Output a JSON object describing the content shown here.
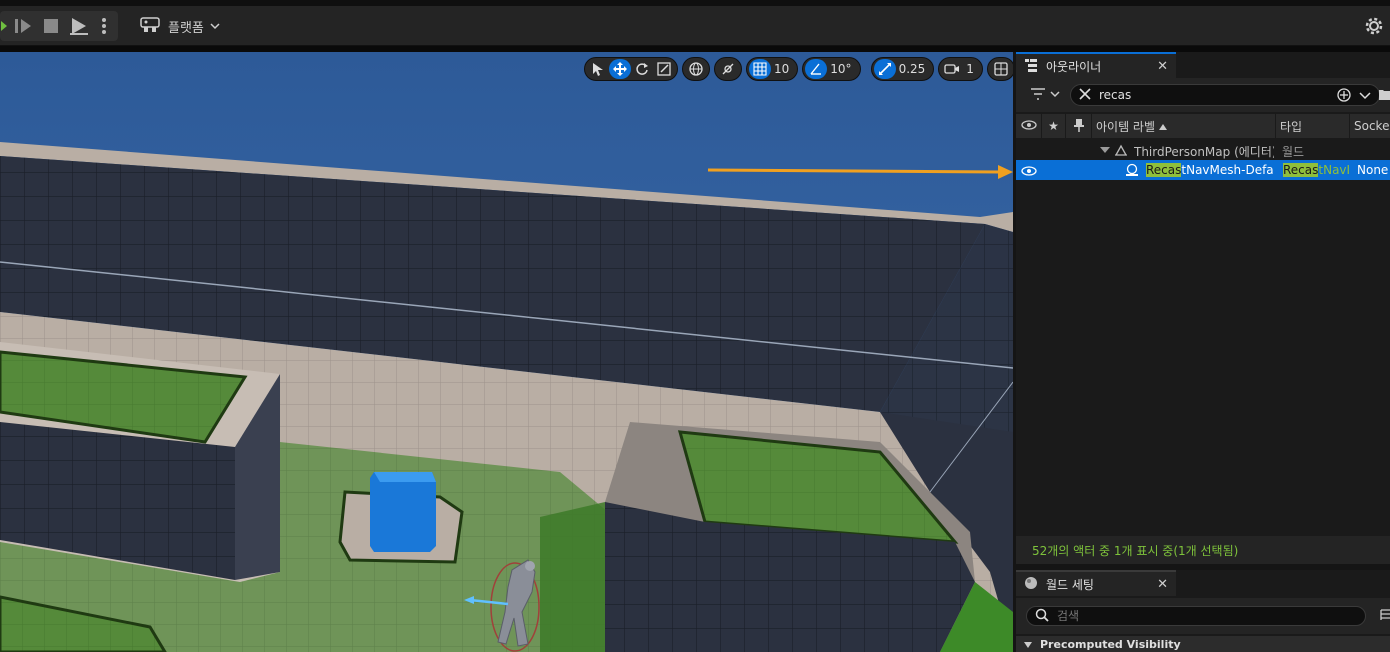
{
  "toolbar": {
    "platform_label": "플랫폼"
  },
  "viewport": {
    "grid_snap": "10",
    "rotation_snap": "10°",
    "scale_snap": "0.25",
    "camera_speed": "1"
  },
  "outliner": {
    "tab_title": "아웃라이너",
    "search_value": "recas",
    "columns": [
      "아이템 라벨",
      "타입",
      "Socke"
    ],
    "rows": [
      {
        "label": "ThirdPersonMap (에디터)",
        "type": "월드",
        "socket": ""
      },
      {
        "label_hl": "Recas",
        "label_rest": "tNavMesh-Defa",
        "type_hl": "Recas",
        "type_rest": "tNavI",
        "socket": "None"
      }
    ],
    "status": "52개의 액터 중 1개 표시 중(1개 선택됨)"
  },
  "world_settings": {
    "tab_title": "월드 세팅",
    "search_placeholder": "검색",
    "section": "Precomputed Visibility"
  },
  "colors": {
    "accent": "#0a6fd6",
    "highlight": "#8fbf3c",
    "arrow": "#f0a020",
    "status_text": "#7ec23b"
  }
}
